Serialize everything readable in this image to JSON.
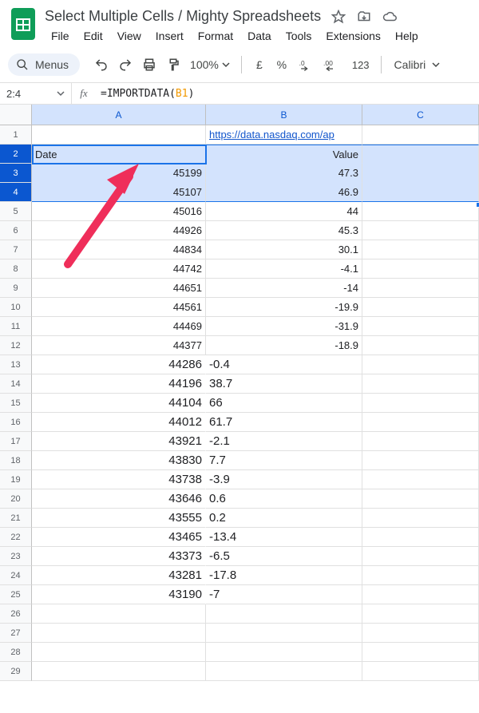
{
  "doc": {
    "name": "Select Multiple Cells / Mighty Spreadsheets"
  },
  "menus": [
    "File",
    "Edit",
    "View",
    "Insert",
    "Format",
    "Data",
    "Tools",
    "Extensions",
    "Help"
  ],
  "toolbar": {
    "menus_label": "Menus",
    "zoom": "100%",
    "currency": "£",
    "percent": "%",
    "dec_dec": ".0",
    "inc_dec": ".00",
    "num_fmt": "123",
    "font": "Calibri"
  },
  "namebox": "2:4",
  "formula": {
    "prefix": "=IMPORTDATA(",
    "ref": "B1",
    "suffix": ")"
  },
  "columns": [
    "A",
    "B",
    "C"
  ],
  "b1_link": "https://data.nasdaq.com/ap",
  "headers": {
    "a": "Date",
    "b": "Value"
  },
  "rows_aligned": [
    {
      "a": "45199",
      "b": "47.3"
    },
    {
      "a": "45107",
      "b": "46.9"
    },
    {
      "a": "45016",
      "b": "44"
    },
    {
      "a": "44926",
      "b": "45.3"
    },
    {
      "a": "44834",
      "b": "30.1"
    },
    {
      "a": "44742",
      "b": "-4.1"
    },
    {
      "a": "44651",
      "b": "-14"
    },
    {
      "a": "44561",
      "b": "-19.9"
    },
    {
      "a": "44469",
      "b": "-31.9"
    },
    {
      "a": "44377",
      "b": "-18.9"
    }
  ],
  "rows_overflow": [
    {
      "a": "44286",
      "b": "-0.4"
    },
    {
      "a": "44196",
      "b": "38.7"
    },
    {
      "a": "44104",
      "b": "66"
    },
    {
      "a": "44012",
      "b": "61.7"
    },
    {
      "a": "43921",
      "b": "-2.1"
    },
    {
      "a": "43830",
      "b": "7.7"
    },
    {
      "a": "43738",
      "b": "-3.9"
    },
    {
      "a": "43646",
      "b": "0.6"
    },
    {
      "a": "43555",
      "b": "0.2"
    },
    {
      "a": "43465",
      "b": "-13.4"
    },
    {
      "a": "43373",
      "b": "-6.5"
    },
    {
      "a": "43281",
      "b": "-17.8"
    },
    {
      "a": "43190",
      "b": "-7"
    }
  ],
  "blank_rows": 4
}
